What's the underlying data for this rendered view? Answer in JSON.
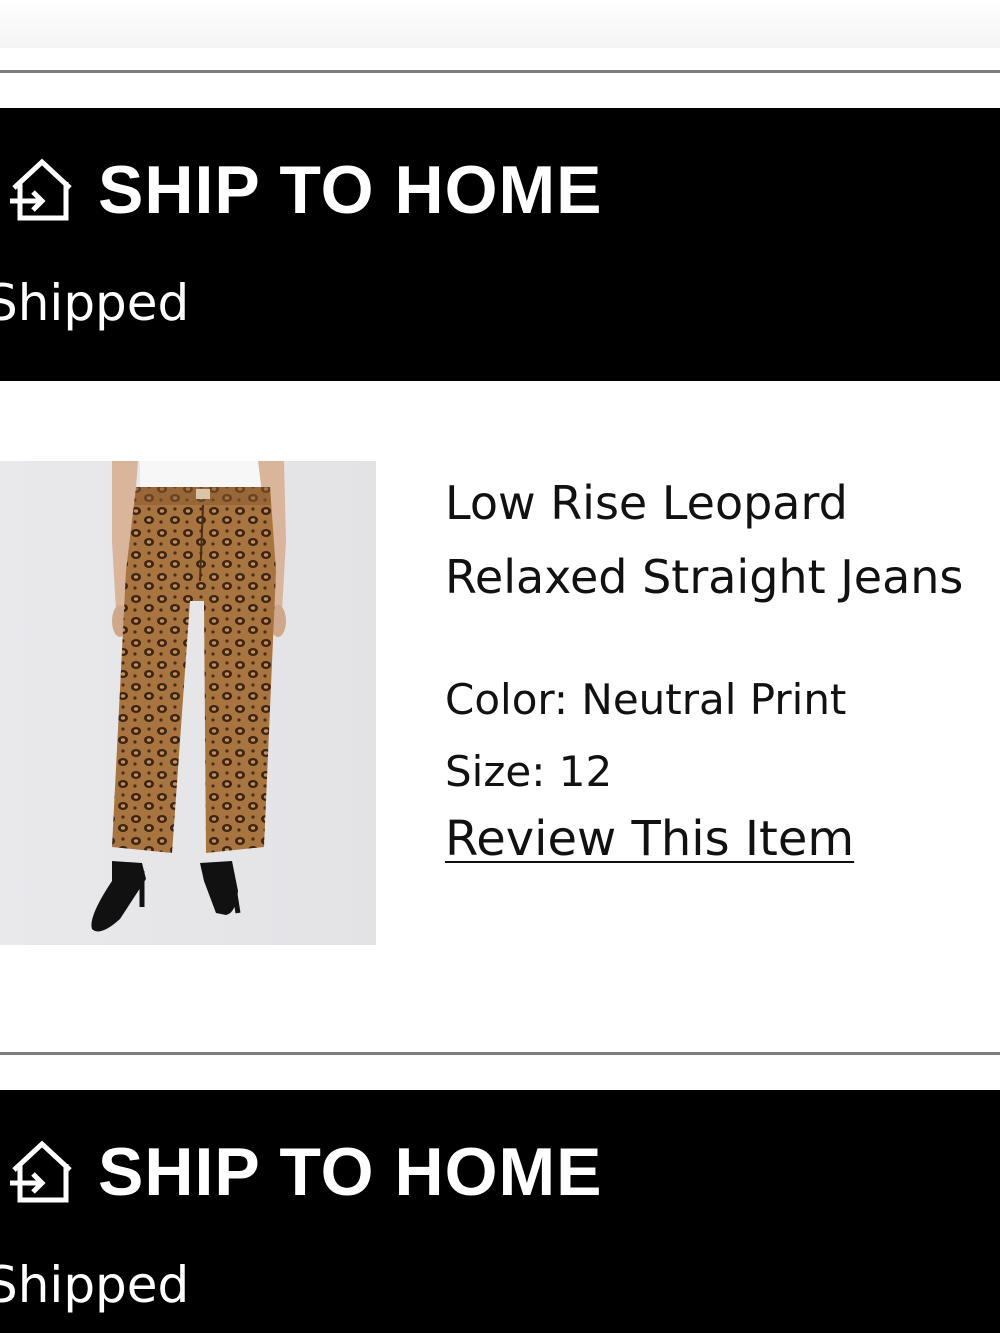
{
  "shipments": [
    {
      "method_label": "SHIP TO HOME",
      "method_icon": "home-arrow-icon",
      "status": "Shipped"
    },
    {
      "method_label": "SHIP TO HOME",
      "method_icon": "home-arrow-icon",
      "status": "Shipped"
    }
  ],
  "items": [
    {
      "name_line1": "Low Rise Leopard",
      "name_line2": "Relaxed Straight Jeans",
      "color": "Color: Neutral Print",
      "size": "Size: 12",
      "review_link": "Review This Item"
    }
  ],
  "colors": {
    "banner_bg": "#000000",
    "banner_text": "#ffffff",
    "divider": "#7d7d7d",
    "text": "#111111"
  }
}
